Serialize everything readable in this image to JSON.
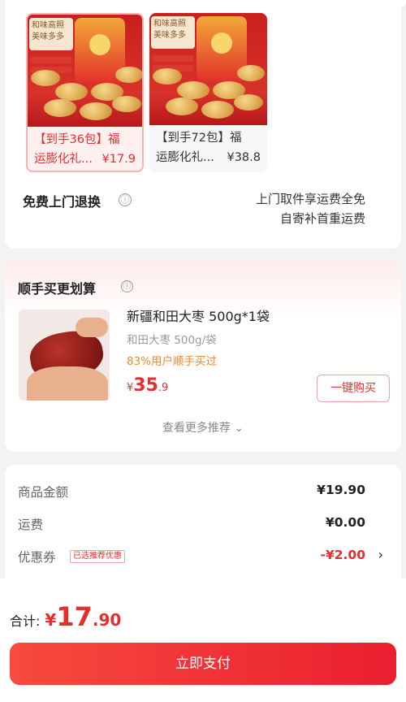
{
  "specs": [
    {
      "title": "【到手36包】福运膨化礼...",
      "line1": "【到手36包】福",
      "line2": "运膨化礼...",
      "price": "¥17.9",
      "selected": true,
      "img_text": "和味高照 美味多多"
    },
    {
      "title": "【到手72包】福运膨化礼...",
      "line1": "【到手72包】福",
      "line2": "运膨化礼...",
      "price": "¥38.8",
      "selected": false,
      "img_text": "和味高照 美味多多"
    }
  ],
  "return_service": {
    "label": "免费上门退换",
    "info_icon": "ⓘ",
    "line1": "上门取件享运费全免",
    "line2": "自寄补首重运费"
  },
  "recommend": {
    "title": "顺手买更划算",
    "product_name": "新疆和田大枣 500g*1袋",
    "product_spec": "和田大枣 500g/袋",
    "stat": "83%用户顺手买过",
    "price_currency": "¥",
    "price_int": "35",
    "price_dec": ".9",
    "buy_label": "一键购买",
    "more_label": "查看更多推荐",
    "more_icon": "⌄"
  },
  "fees": {
    "goods_label": "商品金额",
    "goods_value": "¥19.90",
    "shipping_label": "运费",
    "shipping_value": "¥0.00",
    "coupon_label": "优惠券",
    "coupon_badge": "已选推荐优惠",
    "coupon_value": "-¥2.00",
    "chevron": "›"
  },
  "footer": {
    "total_label": "合计:",
    "currency": "¥",
    "total_int": "17",
    "total_dec": ".90",
    "pay_label": "立即支付"
  },
  "colors": {
    "accent": "#e52f2f",
    "stat": "#f08a2c",
    "pay_start": "#f84a3e",
    "pay_end": "#ea1f2f"
  }
}
